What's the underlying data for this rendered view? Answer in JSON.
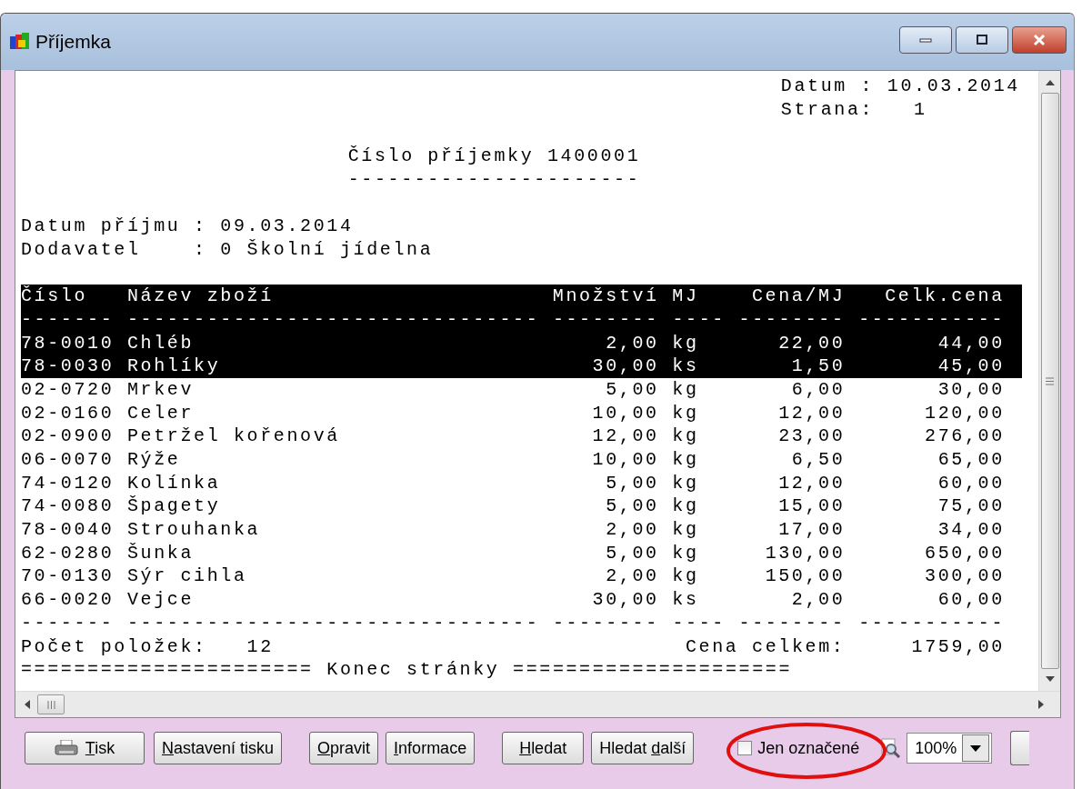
{
  "window": {
    "title": "Příjemka"
  },
  "report": {
    "date_label": "Datum :",
    "date": "10.03.2014",
    "page_label": "Strana:",
    "page": "1",
    "title": "Číslo příjemky 1400001",
    "title_rule": "----------------------",
    "receipt_date_label": "Datum příjmu :",
    "receipt_date": "09.03.2014",
    "supplier_label": "Dodavatel    :",
    "supplier": "0 Školní jídelna",
    "header_selected": true,
    "columns": [
      "Číslo",
      "Název zboží",
      "Množství",
      "MJ",
      "Cena/MJ",
      "Celk.cena"
    ],
    "rule": "------- ------------------------------- -------- ---- -------- -----------",
    "rows": [
      {
        "code": "78-0010",
        "name": "Chléb",
        "qty": "2,00",
        "unit": "kg",
        "price": "22,00",
        "total": "44,00",
        "selected": true
      },
      {
        "code": "78-0030",
        "name": "Rohlíky",
        "qty": "30,00",
        "unit": "ks",
        "price": "1,50",
        "total": "45,00",
        "selected": true
      },
      {
        "code": "02-0720",
        "name": "Mrkev",
        "qty": "5,00",
        "unit": "kg",
        "price": "6,00",
        "total": "30,00",
        "selected": false
      },
      {
        "code": "02-0160",
        "name": "Celer",
        "qty": "10,00",
        "unit": "kg",
        "price": "12,00",
        "total": "120,00",
        "selected": false
      },
      {
        "code": "02-0900",
        "name": "Petržel kořenová",
        "qty": "12,00",
        "unit": "kg",
        "price": "23,00",
        "total": "276,00",
        "selected": false
      },
      {
        "code": "06-0070",
        "name": "Rýže",
        "qty": "10,00",
        "unit": "kg",
        "price": "6,50",
        "total": "65,00",
        "selected": false
      },
      {
        "code": "74-0120",
        "name": "Kolínka",
        "qty": "5,00",
        "unit": "kg",
        "price": "12,00",
        "total": "60,00",
        "selected": false
      },
      {
        "code": "74-0080",
        "name": "Špagety",
        "qty": "5,00",
        "unit": "kg",
        "price": "15,00",
        "total": "75,00",
        "selected": false
      },
      {
        "code": "78-0040",
        "name": "Strouhanka",
        "qty": "2,00",
        "unit": "kg",
        "price": "17,00",
        "total": "34,00",
        "selected": false
      },
      {
        "code": "62-0280",
        "name": "Šunka",
        "qty": "5,00",
        "unit": "kg",
        "price": "130,00",
        "total": "650,00",
        "selected": false
      },
      {
        "code": "70-0130",
        "name": "Sýr cihla",
        "qty": "2,00",
        "unit": "kg",
        "price": "150,00",
        "total": "300,00",
        "selected": false
      },
      {
        "code": "66-0020",
        "name": "Vejce",
        "qty": "30,00",
        "unit": "ks",
        "price": "2,00",
        "total": "60,00",
        "selected": false
      }
    ],
    "footer_rule": "------- ------------------------------- -------- ---- -------- -----------",
    "count_label": "Počet položek:",
    "count": "12",
    "total_label": "Cena celkem:",
    "total": "1759,00",
    "end_line": "====================== Konec stránky ====================="
  },
  "toolbar": {
    "buttons": [
      {
        "label": "Tisk",
        "kind": "print"
      },
      {
        "label": "Nastavení tisku",
        "kind": "text"
      },
      {
        "label": "Opravit",
        "kind": "text"
      },
      {
        "label": "Informace",
        "kind": "text"
      },
      {
        "label": "Hledat",
        "kind": "text"
      },
      {
        "label": "Hledat další",
        "kind": "text"
      }
    ],
    "filter": {
      "label": "Jen označené",
      "checked": false
    },
    "zoom": {
      "value": "100%"
    }
  }
}
